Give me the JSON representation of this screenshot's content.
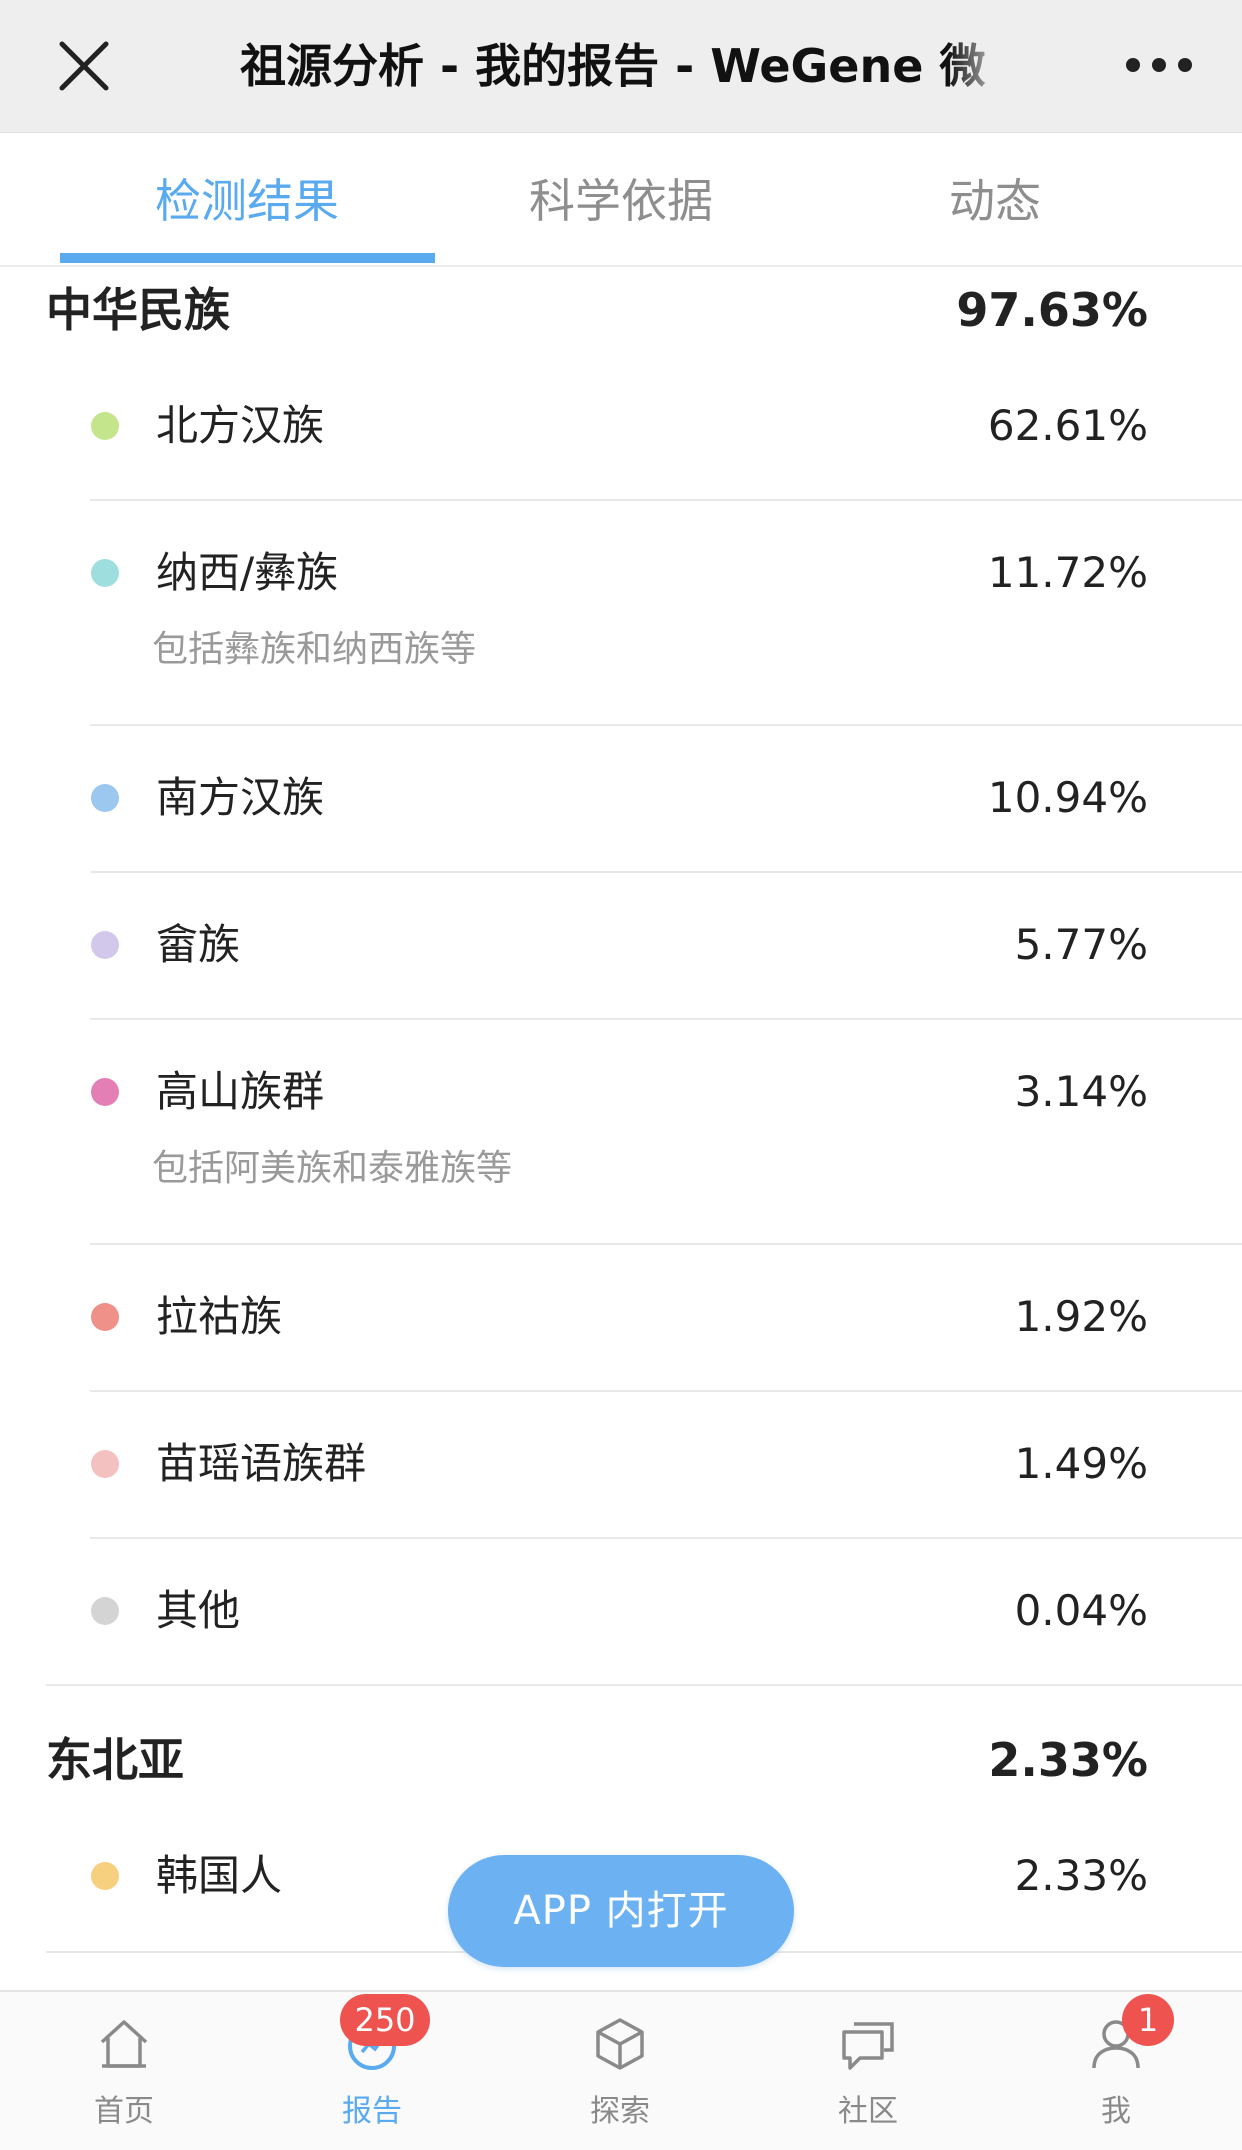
{
  "nav": {
    "title": "祖源分析 - 我的报告 - WeGene 微"
  },
  "tabs": [
    {
      "label": "检测结果",
      "active": true
    },
    {
      "label": "科学依据",
      "active": false
    },
    {
      "label": "动态",
      "active": false
    }
  ],
  "groups": [
    {
      "name": "中华民族",
      "percent": "97.63%",
      "items": [
        {
          "label": "北方汉族",
          "percent": "62.61%",
          "color": "#c5e58d"
        },
        {
          "label": "纳西/彝族",
          "percent": "11.72%",
          "sub": "包括彝族和纳西族等",
          "color": "#9fdede"
        },
        {
          "label": "南方汉族",
          "percent": "10.94%",
          "color": "#9cc7ef"
        },
        {
          "label": "畲族",
          "percent": "5.77%",
          "color": "#d2c8ec"
        },
        {
          "label": "高山族群",
          "percent": "3.14%",
          "sub": "包括阿美族和泰雅族等",
          "color": "#e37fb5"
        },
        {
          "label": "拉祜族",
          "percent": "1.92%",
          "color": "#ef9089"
        },
        {
          "label": "苗瑶语族群",
          "percent": "1.49%",
          "color": "#f3c1c0"
        },
        {
          "label": "其他",
          "percent": "0.04%",
          "color": "#d4d4d4"
        }
      ]
    },
    {
      "name": "东北亚",
      "percent": "2.33%",
      "items": [
        {
          "label": "韩国人",
          "percent": "2.33%",
          "color": "#f7d07f"
        }
      ]
    }
  ],
  "floating_button": {
    "label": "APP 内打开"
  },
  "bottom_tabs": [
    {
      "label": "首页",
      "icon": "home-icon",
      "active": false
    },
    {
      "label": "报告",
      "icon": "report-icon",
      "active": true,
      "badge": "250"
    },
    {
      "label": "探索",
      "icon": "cube-icon",
      "active": false
    },
    {
      "label": "社区",
      "icon": "chat-icon",
      "active": false
    },
    {
      "label": "我",
      "icon": "user-icon",
      "active": false,
      "badge": "1"
    }
  ],
  "colors": {
    "accent": "#5aaaf0",
    "button": "#6cb1f2",
    "badge": "#ef5350"
  }
}
